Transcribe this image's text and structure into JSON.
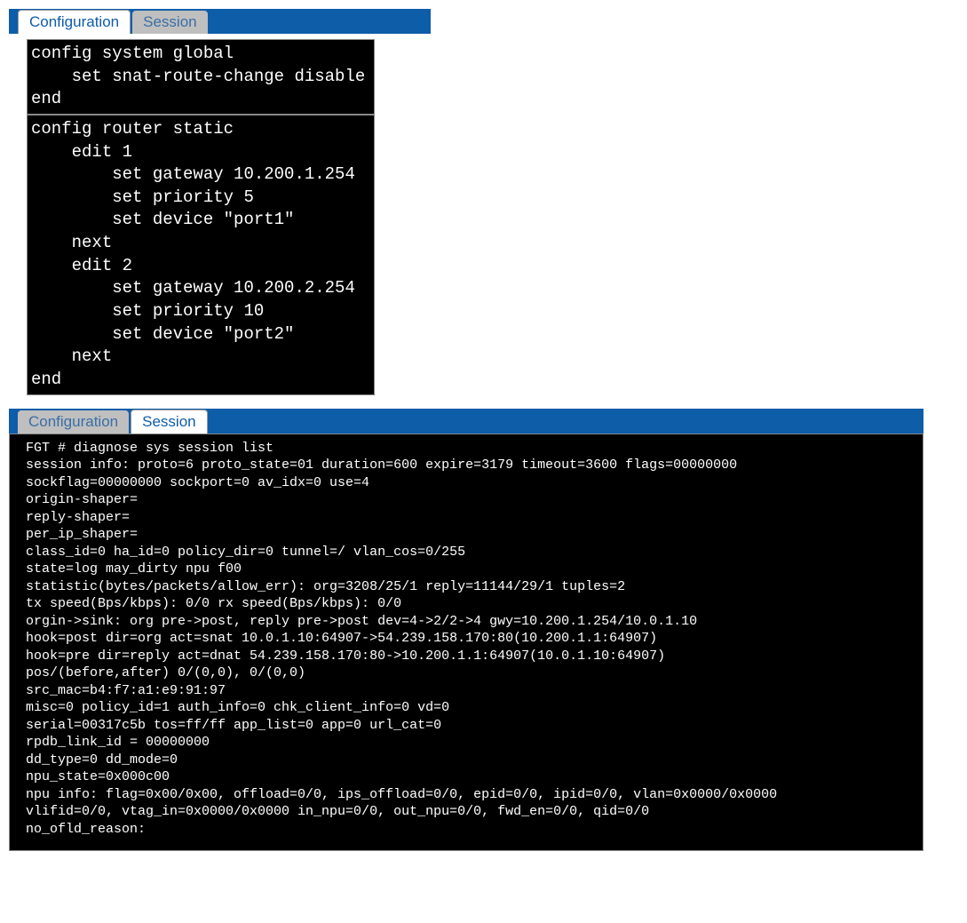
{
  "panel1": {
    "tabs": [
      {
        "label": "Configuration",
        "active": true
      },
      {
        "label": "Session",
        "active": false
      }
    ],
    "code_block1": "config system global\n    set snat-route-change disable\nend",
    "code_block2": "config router static\n    edit 1\n        set gateway 10.200.1.254\n        set priority 5\n        set device \"port1\"\n    next\n    edit 2\n        set gateway 10.200.2.254\n        set priority 10\n        set device \"port2\"\n    next\nend"
  },
  "panel2": {
    "tabs": [
      {
        "label": "Configuration",
        "active": false
      },
      {
        "label": "Session",
        "active": true
      }
    ],
    "session_text": "FGT # diagnose sys session list\nsession info: proto=6 proto_state=01 duration=600 expire=3179 timeout=3600 flags=00000000\nsockflag=00000000 sockport=0 av_idx=0 use=4\norigin-shaper=\nreply-shaper=\nper_ip_shaper=\nclass_id=0 ha_id=0 policy_dir=0 tunnel=/ vlan_cos=0/255\nstate=log may_dirty npu f00\nstatistic(bytes/packets/allow_err): org=3208/25/1 reply=11144/29/1 tuples=2\ntx speed(Bps/kbps): 0/0 rx speed(Bps/kbps): 0/0\norgin->sink: org pre->post, reply pre->post dev=4->2/2->4 gwy=10.200.1.254/10.0.1.10\nhook=post dir=org act=snat 10.0.1.10:64907->54.239.158.170:80(10.200.1.1:64907)\nhook=pre dir=reply act=dnat 54.239.158.170:80->10.200.1.1:64907(10.0.1.10:64907)\npos/(before,after) 0/(0,0), 0/(0,0)\nsrc_mac=b4:f7:a1:e9:91:97\nmisc=0 policy_id=1 auth_info=0 chk_client_info=0 vd=0\nserial=00317c5b tos=ff/ff app_list=0 app=0 url_cat=0\nrpdb_link_id = 00000000\ndd_type=0 dd_mode=0\nnpu_state=0x000c00\nnpu info: flag=0x00/0x00, offload=0/0, ips_offload=0/0, epid=0/0, ipid=0/0, vlan=0x0000/0x0000\nvlifid=0/0, vtag_in=0x0000/0x0000 in_npu=0/0, out_npu=0/0, fwd_en=0/0, qid=0/0\nno_ofld_reason:"
  }
}
